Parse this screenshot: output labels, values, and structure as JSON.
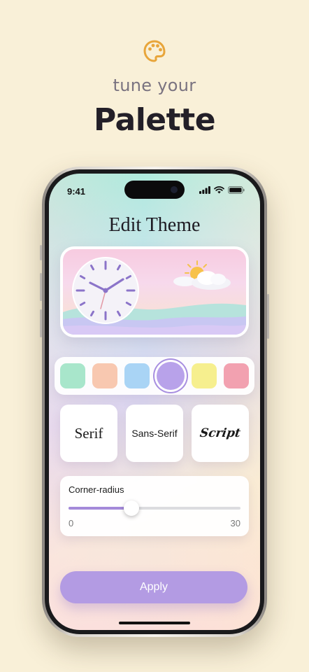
{
  "header": {
    "icon": "palette-icon",
    "tagline": "tune your",
    "headline": "Palette"
  },
  "status_bar": {
    "time": "9:41",
    "icons": [
      "signal-icon",
      "wifi-icon",
      "battery-icon"
    ]
  },
  "screen": {
    "title": "Edit Theme",
    "preview": {
      "icons": [
        "clock-icon",
        "sun-cloud-icon"
      ],
      "clock_time": "10:10"
    },
    "swatches": [
      {
        "color": "#a8e6cb",
        "selected": false
      },
      {
        "color": "#f8c8b0",
        "selected": false
      },
      {
        "color": "#a9d4f5",
        "selected": false
      },
      {
        "color": "#b8a2ea",
        "selected": true
      },
      {
        "color": "#f6ef8e",
        "selected": false
      },
      {
        "color": "#f2a1b0",
        "selected": false
      }
    ],
    "fonts": [
      {
        "label": "Serif"
      },
      {
        "label": "Sans-Serif"
      },
      {
        "label": "Script"
      }
    ],
    "corner_radius": {
      "label": "Corner-radius",
      "min": "0",
      "max": "30",
      "value": 11
    },
    "apply_label": "Apply"
  },
  "colors": {
    "background": "#f9f0d8",
    "accent": "#b39be3",
    "icon": "#e8a53a"
  }
}
